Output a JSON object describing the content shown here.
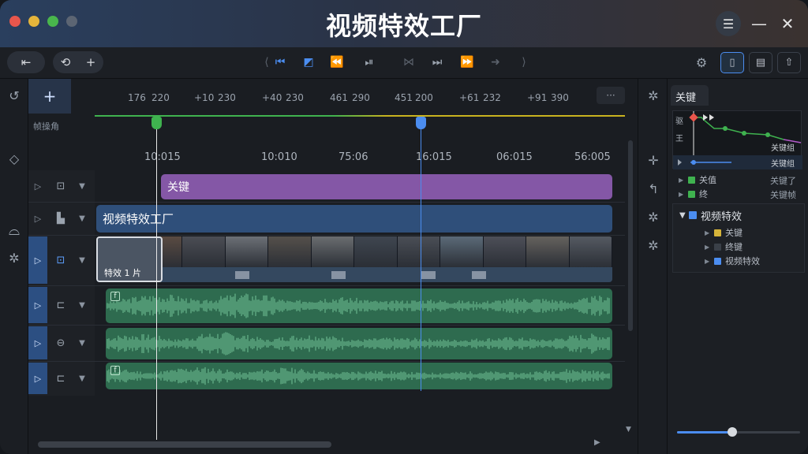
{
  "title_bar": {
    "title": "视频特效工厂",
    "colors": {
      "close": "#e8564c",
      "minimize": "#e5b53b",
      "zoom": "#49b64c",
      "disabled": "#5c6573"
    },
    "icons": {
      "menu": "menu-list-icon",
      "minimize": "minimize-icon",
      "close": "close-icon"
    }
  },
  "toolbar": {
    "icons": {
      "left": [
        "import-icon",
        "history-icon",
        "add-icon"
      ],
      "transport": [
        "skip-back-icon",
        "loop-icon",
        "rewind-icon",
        "step-back-icon",
        "split-icon",
        "step-forward-icon",
        "fast-forward-icon",
        "forward-arrow-icon"
      ],
      "right": [
        "settings-gear-icon",
        "info-panel-icon",
        "edit-panel-icon",
        "export-icon"
      ]
    }
  },
  "left_strip": {
    "icons": [
      "keyframe-curve-icon",
      "diamond-icon",
      "user-icon",
      "gear-icon"
    ]
  },
  "timeline": {
    "add_label": "+",
    "ruler_side_label": "帧操角",
    "ruler_labels": [
      "176",
      "220",
      "+10",
      "230",
      "+40",
      "230",
      "461",
      "290",
      "451",
      "200",
      "+61",
      "232",
      "+91",
      "390"
    ],
    "time_labels": [
      "10:015",
      "10:010",
      "75:06",
      "16:015",
      "06:015",
      "56:005"
    ],
    "more_label": "···",
    "tracks": [
      {
        "icon": "keyframe-track-icon",
        "clip_label": "关键",
        "color": "#8457a6"
      },
      {
        "icon": "title-track-icon",
        "clip_label": "视频特效工厂",
        "color": "#2f4f7a"
      },
      {
        "icon": "video-track-icon",
        "clip_label": "特效 1 片",
        "color": "#29384f"
      },
      {
        "icon": "audio-track-icon",
        "clip_label": "",
        "color": "#2e6b4f"
      },
      {
        "icon": "audio-search-icon",
        "clip_label": "",
        "color": "#2e6b4f"
      },
      {
        "icon": "audio-track-icon",
        "clip_label": "",
        "color": "#2e6b4f"
      }
    ],
    "thumbnail_colors": [
      "#6a6f73",
      "#5a4b42",
      "#4b4d54",
      "#6c7076",
      "#55504b",
      "#6a6d70",
      "#3f4650",
      "#4a4e56",
      "#5b6a78",
      "#4d4f58",
      "#65625e",
      "#555a62"
    ],
    "playhead_colors": {
      "white": "#e8e8e8",
      "green": "#3fb24f",
      "blue": "#4b8df0"
    }
  },
  "mid_strip": {
    "icons": [
      "gear-icon",
      "crosshair-icon",
      "undo-icon",
      "gear-badge-icon",
      "gear-icon"
    ]
  },
  "right_panel": {
    "tab_label": "关键",
    "kf_row_labels": [
      "驱",
      "王"
    ],
    "kf_right_labels": [
      "关键组",
      "关键组"
    ],
    "tree": [
      {
        "label": "关值",
        "right": "关键了",
        "color": "#3fb24f"
      },
      {
        "label": "终",
        "right": "关键帧",
        "color": "#3fb24f"
      }
    ],
    "group": {
      "label": "视频特效",
      "children": [
        {
          "label": "关键",
          "color": "#d6b43a"
        },
        {
          "label": "终键",
          "color": "#3a4048"
        },
        {
          "label": "视频特效",
          "color": "#4b8df0"
        }
      ]
    },
    "zoom_level": 0.45
  }
}
